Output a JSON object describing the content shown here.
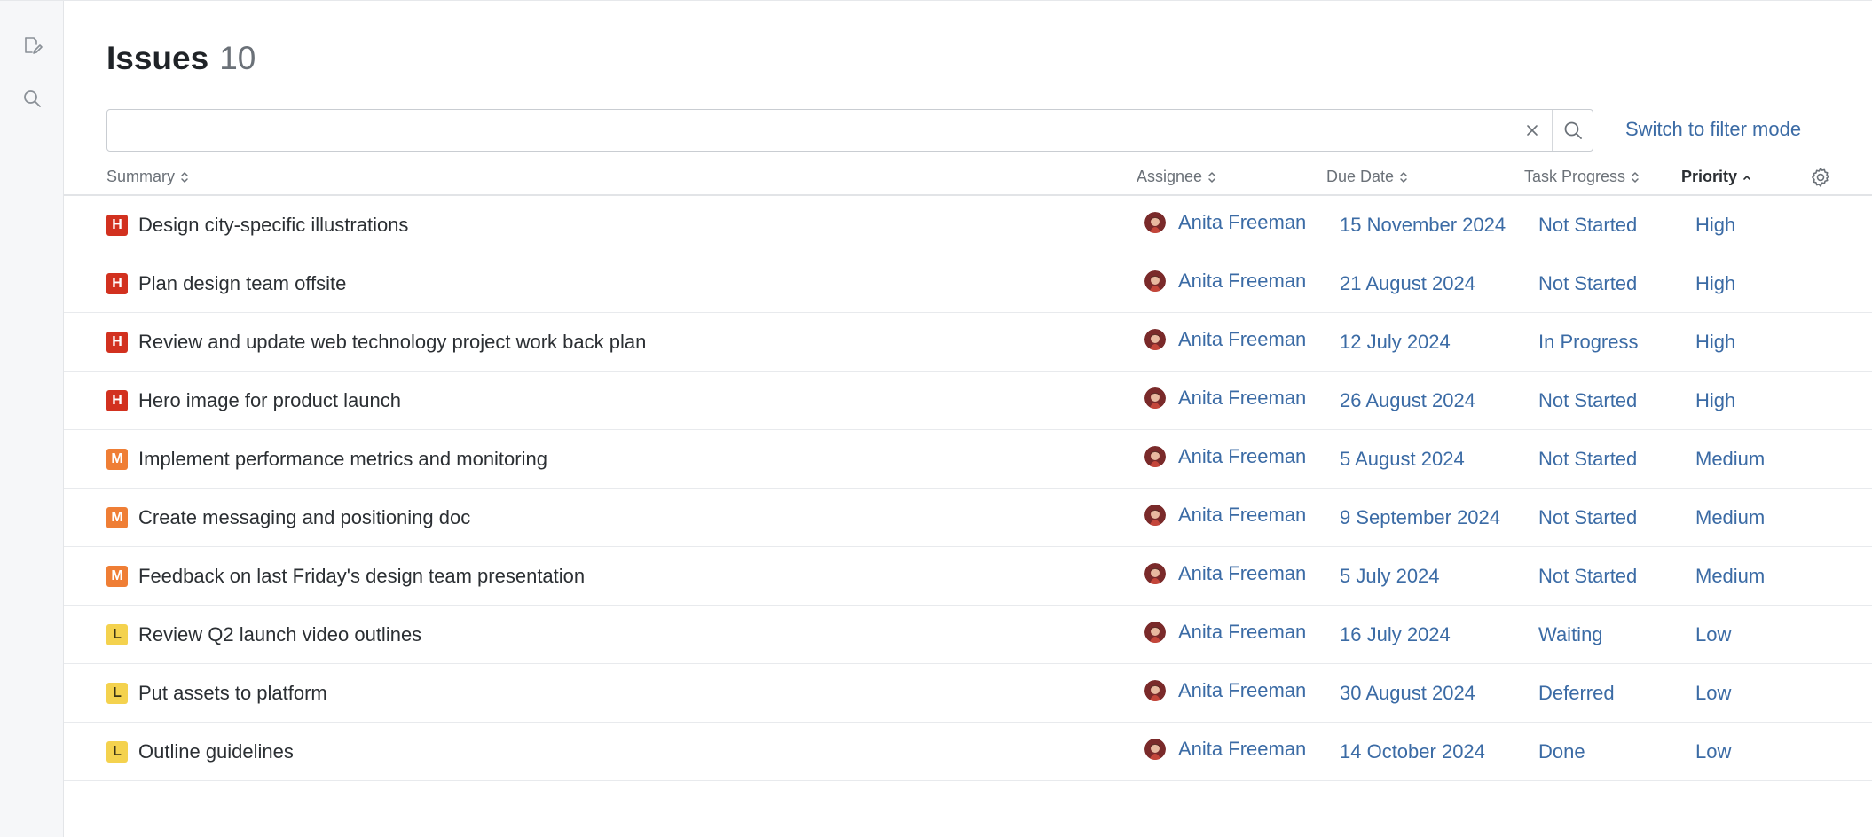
{
  "header": {
    "title": "Issues",
    "count": "10"
  },
  "search": {
    "value": "",
    "placeholder": "",
    "mode_link": "Switch to filter mode"
  },
  "columns": {
    "summary": "Summary",
    "assignee": "Assignee",
    "due_date": "Due Date",
    "task_progress": "Task Progress",
    "priority": "Priority"
  },
  "colors": {
    "accent": "#3b6ba5",
    "high": "#d2311f",
    "medium": "#ef7e35",
    "low": "#f4d24e"
  },
  "rows": [
    {
      "badge": "H",
      "summary": "Design city-specific illustrations",
      "assignee": "Anita Freeman",
      "due": "15 November 2024",
      "progress": "Not Started",
      "priority": "High"
    },
    {
      "badge": "H",
      "summary": "Plan design team offsite",
      "assignee": "Anita Freeman",
      "due": "21 August 2024",
      "progress": "Not Started",
      "priority": "High"
    },
    {
      "badge": "H",
      "summary": "Review and update web technology project work back plan",
      "assignee": "Anita Freeman",
      "due": "12 July 2024",
      "progress": "In Progress",
      "priority": "High"
    },
    {
      "badge": "H",
      "summary": "Hero image for product launch",
      "assignee": "Anita Freeman",
      "due": "26 August 2024",
      "progress": "Not Started",
      "priority": "High"
    },
    {
      "badge": "M",
      "summary": "Implement performance metrics and monitoring",
      "assignee": "Anita Freeman",
      "due": "5 August 2024",
      "progress": "Not Started",
      "priority": "Medium"
    },
    {
      "badge": "M",
      "summary": "Create messaging and positioning doc",
      "assignee": "Anita Freeman",
      "due": "9 September 2024",
      "progress": "Not Started",
      "priority": "Medium"
    },
    {
      "badge": "M",
      "summary": "Feedback on last Friday's design team presentation",
      "assignee": "Anita Freeman",
      "due": "5 July 2024",
      "progress": "Not Started",
      "priority": "Medium"
    },
    {
      "badge": "L",
      "summary": "Review Q2 launch video outlines",
      "assignee": "Anita Freeman",
      "due": "16 July 2024",
      "progress": "Waiting",
      "priority": "Low"
    },
    {
      "badge": "L",
      "summary": "Put assets to platform",
      "assignee": "Anita Freeman",
      "due": "30 August 2024",
      "progress": "Deferred",
      "priority": "Low"
    },
    {
      "badge": "L",
      "summary": "Outline guidelines",
      "assignee": "Anita Freeman",
      "due": "14 October 2024",
      "progress": "Done",
      "priority": "Low"
    }
  ]
}
